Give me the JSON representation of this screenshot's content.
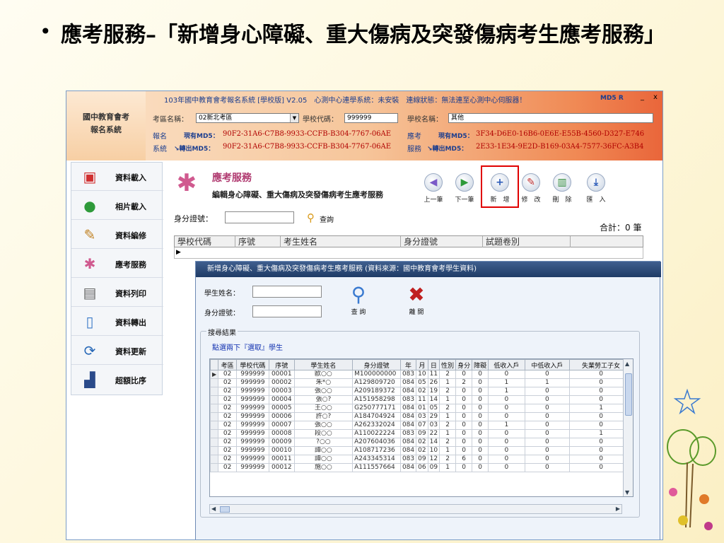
{
  "slide": {
    "bullet": "•",
    "title": "應考服務–「新增身心障礙、重大傷病及突發傷病考生應考服務」"
  },
  "app": {
    "titlebar": "103年國中教育會考報名系統 [學校版] V2.05　心測中心連學系統：未安裝　連線狀態：無法連至心測中心伺服器！",
    "md5r": "MD5 R",
    "minimize": "_",
    "close": "x",
    "logo_line1": "國中教育會考",
    "logo_line2": "報名系統",
    "exam_area_label": "考區名稱：",
    "exam_area_value": "02新北考區",
    "school_code_label": "學校代碼：",
    "school_code_value": "999999",
    "school_name_label": "學校名稱：",
    "school_name_value": "其他",
    "reg_label1": "報名",
    "reg_label2": "系統",
    "reg_current_key": "現有MD5：",
    "reg_current_val": "90F2-31A6-C7B8-9933-CCFB-B304-7767-06AE",
    "reg_export_key": "↘轉出MD5：",
    "reg_export_val": "90F2-31A6-C7B8-9933-CCFB-B304-7767-06AE",
    "svc_label1": "應考",
    "svc_label2": "服務",
    "svc_current_key": "現有MD5：",
    "svc_current_val": "3F34-D6E0-16B6-0E6E-E55B-4560-D327-E746",
    "svc_export_key": "↘轉出MD5：",
    "svc_export_val": "2E33-1E34-9E2D-B169-03A4-7577-36FC-A3B4"
  },
  "sidebar": {
    "items": [
      {
        "label": "資料載入",
        "icon": "clipboard-icon",
        "glyph": "📋",
        "color": "#d03030"
      },
      {
        "label": "相片載入",
        "icon": "person-icon",
        "glyph": "👤",
        "color": "#2e9a3a"
      },
      {
        "label": "資料編修",
        "icon": "edit-icon",
        "glyph": "📝",
        "color": "#c08020"
      },
      {
        "label": "應考服務",
        "icon": "service-icon",
        "glyph": "✱",
        "color": "#d05a8f"
      },
      {
        "label": "資料列印",
        "icon": "printer-icon",
        "glyph": "🖨",
        "color": "#666666"
      },
      {
        "label": "資料轉出",
        "icon": "document-icon",
        "glyph": "📄",
        "color": "#3a7ac8"
      },
      {
        "label": "資料更新",
        "icon": "refresh-icon",
        "glyph": "⟳",
        "color": "#2a6ab8"
      },
      {
        "label": "超額比序",
        "icon": "bar-chart-icon",
        "glyph": "▟",
        "color": "#2a4a8a"
      }
    ]
  },
  "panel": {
    "title": "應考服務",
    "subtitle": "編輯身心障礙、重大傷病及突發傷病考生應考服務",
    "toolbar": {
      "prev": "上一筆",
      "next": "下一筆",
      "add": "新　增",
      "edit": "修　改",
      "delete": "刪　除",
      "import": "匯　入"
    },
    "id_label": "身分證號：",
    "search_label": "查詢",
    "total": "合計：0 筆",
    "grid_headers": [
      "學校代碼",
      "序號",
      "考生姓名",
      "身分證號",
      "試題卷別"
    ]
  },
  "dialog": {
    "title": "新增身心障礙、重大傷病及突發傷病考生應考服務 (資料來源：國中教育會考學生資料)",
    "name_label": "學生姓名：",
    "id_label": "身分證號：",
    "query_label": "查 詢",
    "leave_label": "離 開",
    "results_legend": "搜尋結果",
    "results_hint": "點選兩下『選取』學生",
    "columns": [
      "考區",
      "學校代碼",
      "序號",
      "學生姓名",
      "身分證號",
      "年",
      "月",
      "日",
      "性別",
      "身分",
      "障礙",
      "低收入戶",
      "中低收入戶",
      "失業勞工子女"
    ],
    "rows": [
      [
        "02",
        "999999",
        "00001",
        "歐○○",
        "M100000000",
        "083",
        "10",
        "11",
        "2",
        "0",
        "0",
        "0",
        "0",
        "0"
      ],
      [
        "02",
        "999999",
        "00002",
        "朱*○",
        "A129809720",
        "084",
        "05",
        "26",
        "1",
        "2",
        "0",
        "1",
        "1",
        "0"
      ],
      [
        "02",
        "999999",
        "00003",
        "張○○",
        "A209189372",
        "084",
        "02",
        "19",
        "2",
        "0",
        "0",
        "1",
        "0",
        "0"
      ],
      [
        "02",
        "999999",
        "00004",
        "張○?",
        "A151958298",
        "083",
        "11",
        "14",
        "1",
        "0",
        "0",
        "0",
        "0",
        "0"
      ],
      [
        "02",
        "999999",
        "00005",
        "王○○",
        "G250777171",
        "084",
        "01",
        "05",
        "2",
        "0",
        "0",
        "0",
        "0",
        "1"
      ],
      [
        "02",
        "999999",
        "00006",
        "許○?",
        "A184704924",
        "084",
        "03",
        "29",
        "1",
        "0",
        "0",
        "0",
        "0",
        "0"
      ],
      [
        "02",
        "999999",
        "00007",
        "張○○",
        "A262332024",
        "084",
        "07",
        "03",
        "2",
        "0",
        "0",
        "1",
        "0",
        "0"
      ],
      [
        "02",
        "999999",
        "00008",
        "段○○",
        "A110022224",
        "083",
        "09",
        "22",
        "1",
        "0",
        "0",
        "0",
        "0",
        "1"
      ],
      [
        "02",
        "999999",
        "00009",
        "?○○",
        "A207604036",
        "084",
        "02",
        "14",
        "2",
        "0",
        "0",
        "0",
        "0",
        "0"
      ],
      [
        "02",
        "999999",
        "00010",
        "譚○○",
        "A108717236",
        "084",
        "02",
        "10",
        "1",
        "0",
        "0",
        "0",
        "0",
        "0"
      ],
      [
        "02",
        "999999",
        "00011",
        "譚○○",
        "A243345314",
        "083",
        "09",
        "12",
        "2",
        "6",
        "0",
        "0",
        "0",
        "0"
      ],
      [
        "02",
        "999999",
        "00012",
        "施○○",
        "A111557664",
        "084",
        "06",
        "09",
        "1",
        "0",
        "0",
        "0",
        "0",
        "0"
      ]
    ]
  }
}
